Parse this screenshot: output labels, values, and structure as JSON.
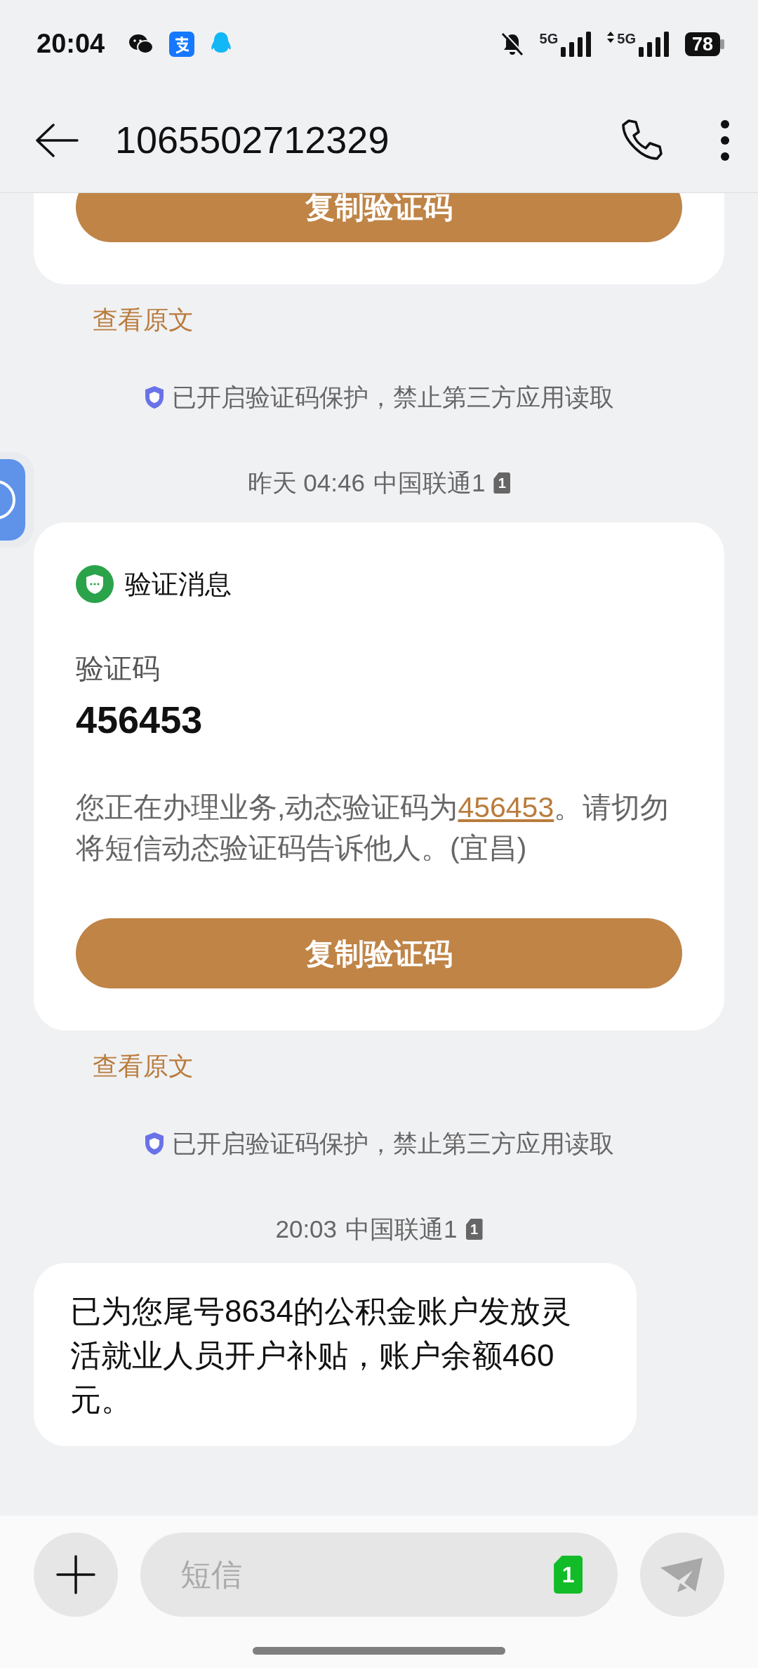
{
  "status_bar": {
    "time": "20:04",
    "sim1_network": "5G",
    "sim2_network": "5G",
    "battery": "78"
  },
  "header": {
    "title": "1065502712329"
  },
  "thread": [
    {
      "kind": "otp_card",
      "button": "复制验证码"
    },
    {
      "kind": "link",
      "text": "查看原文"
    },
    {
      "kind": "notice",
      "text": "已开启验证码保护，禁止第三方应用读取"
    },
    {
      "kind": "timestamp",
      "time": "昨天 04:46",
      "carrier": "中国联通1",
      "sim": "1"
    },
    {
      "kind": "otp_card",
      "header": "验证消息",
      "label": "验证码",
      "code": "456453",
      "body_before": "您正在办理业务,动态验证码为",
      "body_link": "456453",
      "body_after": "。请切勿将短信动态验证码告诉他人。(宜昌)",
      "button": "复制验证码"
    },
    {
      "kind": "link",
      "text": "查看原文"
    },
    {
      "kind": "notice",
      "text": "已开启验证码保护，禁止第三方应用读取"
    },
    {
      "kind": "timestamp",
      "time": "20:03",
      "carrier": "中国联通1",
      "sim": "1"
    },
    {
      "kind": "bubble",
      "text": "已为您尾号8634的公积金账户发放灵活就业人员开户补贴，账户余额460元。"
    }
  ],
  "composer": {
    "placeholder": "短信",
    "sim": "1"
  }
}
